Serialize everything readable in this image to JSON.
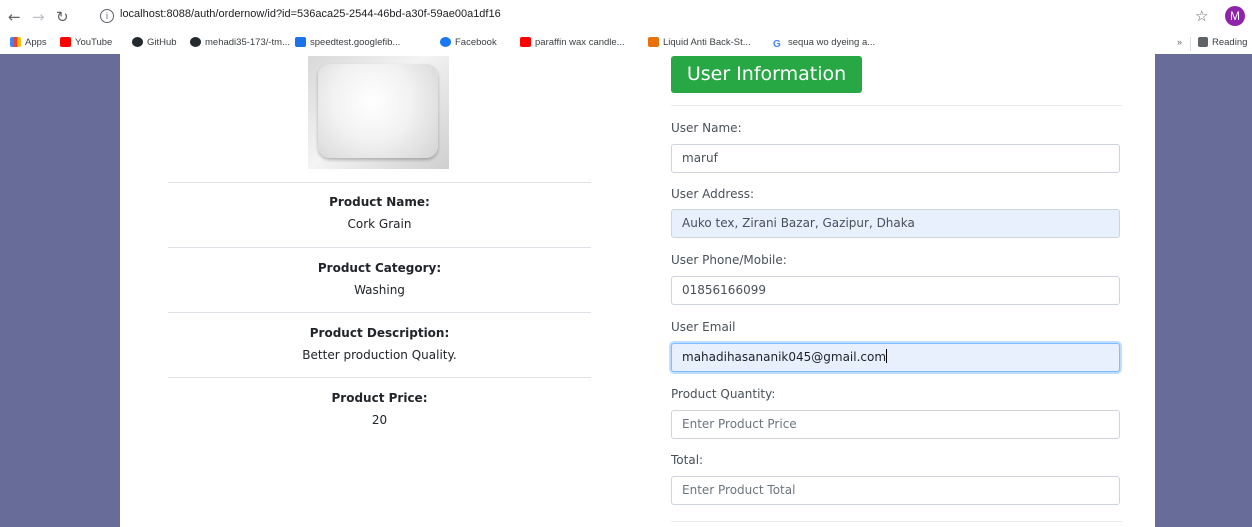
{
  "browser": {
    "url": "localhost:8088/auth/ordernow/id?id=536aca25-2544-46bd-a30f-59ae00a1df16",
    "avatar_letter": "M",
    "bookmarks": [
      {
        "label": "Apps",
        "color": "#4285f4"
      },
      {
        "label": "YouTube",
        "color": "#ff0000"
      },
      {
        "label": "GitHub",
        "color": "#24292e"
      },
      {
        "label": "mehadi35-173/-tm...",
        "color": "#24292e"
      },
      {
        "label": "speedtest.googlefib...",
        "color": "#1a73e8"
      },
      {
        "label": "Facebook",
        "color": "#1877f2"
      },
      {
        "label": "paraffin wax candle...",
        "color": "#ff0000"
      },
      {
        "label": "Liquid Anti Back-St...",
        "color": "#e8710a"
      },
      {
        "label": "sequa wo dyeing a...",
        "color": "#4285f4"
      }
    ],
    "reading_list": "Reading"
  },
  "product": {
    "name_label": "Product Name:",
    "name": "Cork Grain",
    "category_label": "Product Category:",
    "category": "Washing",
    "description_label": "Product Description:",
    "description": "Better production Quality.",
    "price_label": "Product Price:",
    "price": "20"
  },
  "form": {
    "header": "User Information",
    "user_name_label": "User Name:",
    "user_name": "maruf",
    "address_label": "User Address:",
    "address": "Auko tex, Zirani Bazar, Gazipur, Dhaka",
    "phone_label": "User Phone/Mobile:",
    "phone": "01856166099",
    "email_label": "User Email",
    "email": "mahadihasananik045@gmail.com",
    "quantity_label": "Product Quantity:",
    "quantity_placeholder": "Enter Product Price",
    "total_label": "Total:",
    "total_placeholder": "Enter Product Total"
  },
  "colors": {
    "page_background": "#676c98",
    "header_button": "#28a745",
    "autofill": "#e8f0fe"
  }
}
